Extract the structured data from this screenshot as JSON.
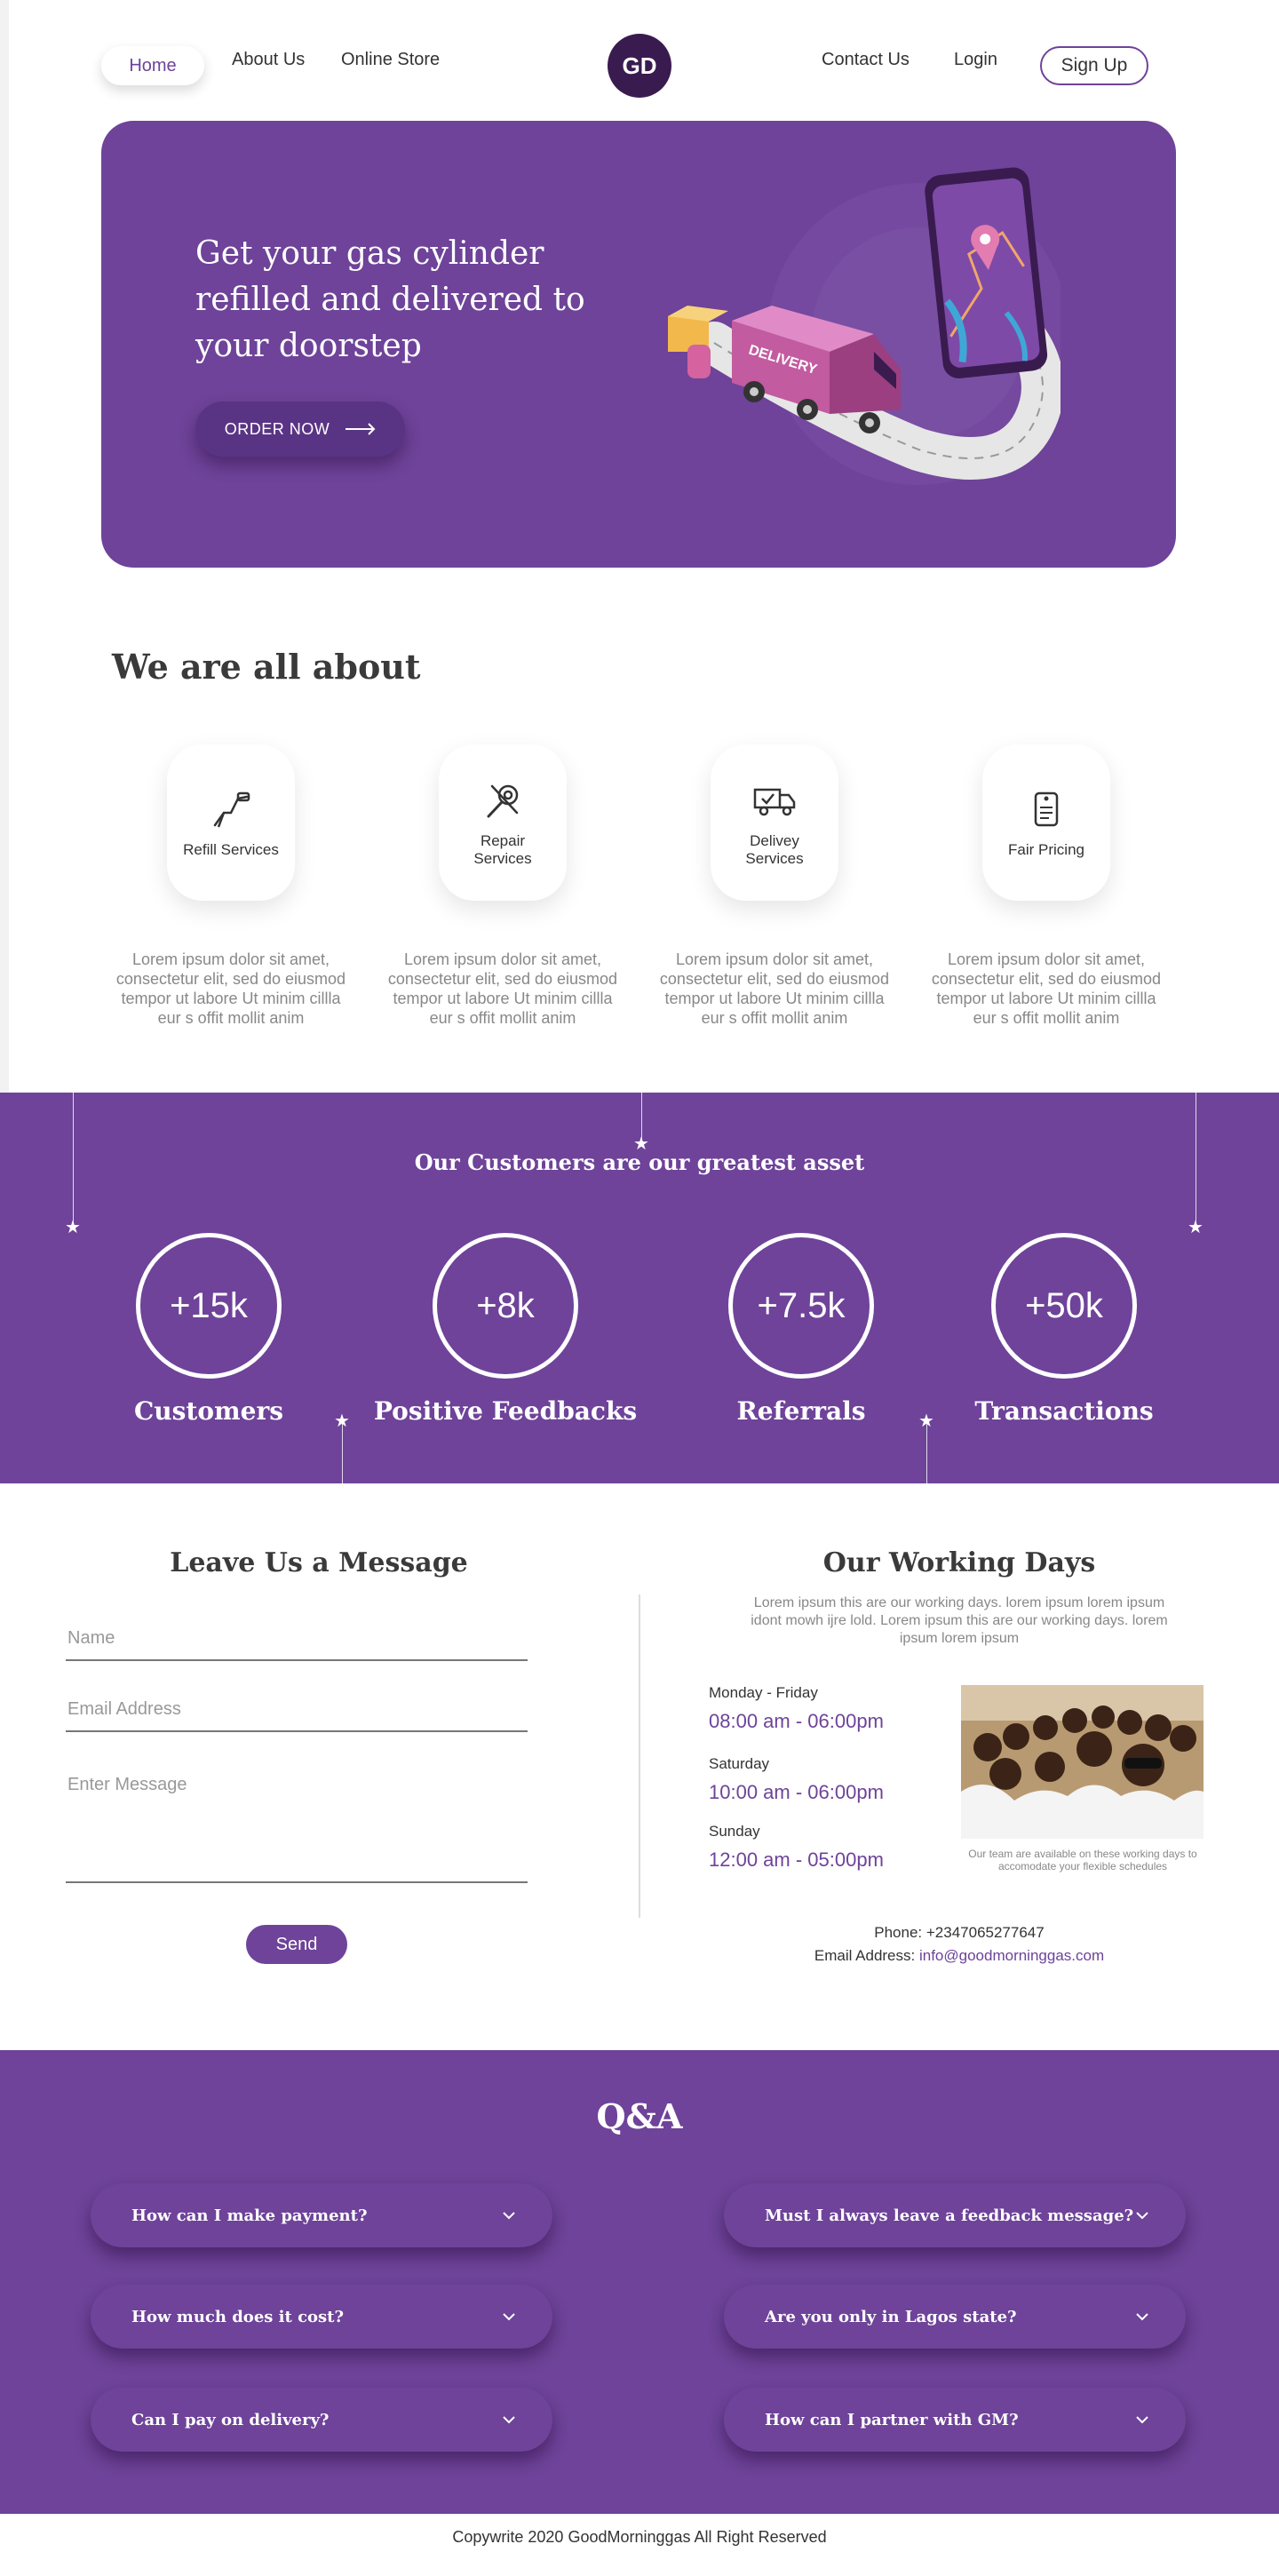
{
  "nav": {
    "home": "Home",
    "about": "About Us",
    "store": "Online Store",
    "logo": "GD",
    "contact": "Contact Us",
    "login": "Login",
    "signup": "Sign Up"
  },
  "hero": {
    "title": "Get your gas cylinder refilled and delivered to your doorstep",
    "cta": "ORDER NOW",
    "van_label": "DELIVERY"
  },
  "about": {
    "title": "We are all about",
    "services": [
      {
        "label": "Refill Services",
        "icon": "gas-nozzle-icon",
        "desc": "Lorem ipsum dolor sit amet, consectetur elit, sed do eiusmod tempor ut labore Ut minim  cillla eur s offit mollit anim"
      },
      {
        "label": "Repair Services",
        "icon": "tools-icon",
        "desc": "Lorem ipsum dolor sit amet, consectetur elit, sed do eiusmod tempor ut labore Ut minim  cillla eur s offit mollit anim"
      },
      {
        "label": "Delivey Services",
        "icon": "delivery-truck-icon",
        "desc": "Lorem ipsum dolor sit amet, consectetur elit, sed do eiusmod tempor ut labore Ut minim  cillla eur s offit mollit anim"
      },
      {
        "label": "Fair Pricing",
        "icon": "price-tag-icon",
        "desc": "Lorem ipsum dolor sit amet, consectetur elit, sed do eiusmod tempor ut labore Ut minim  cillla eur s offit mollit anim"
      }
    ]
  },
  "stats": {
    "title": "Our Customers are our greatest asset",
    "items": [
      {
        "value": "+15k",
        "label": "Customers"
      },
      {
        "value": "+8k",
        "label": "Positive Feedbacks"
      },
      {
        "value": "+7.5k",
        "label": "Referrals"
      },
      {
        "value": "+50k",
        "label": "Transactions"
      }
    ]
  },
  "message": {
    "title": "Leave Us a Message",
    "name_placeholder": "Name",
    "email_placeholder": "Email Address",
    "message_placeholder": "Enter Message",
    "send": "Send"
  },
  "working": {
    "title": "Our Working Days",
    "desc": "Lorem ipsum this are our working days. lorem ipsum lorem ipsum idont mowh ijre lold. Lorem ipsum this are our working days. lorem ipsum lorem ipsum",
    "days": [
      {
        "day": "Monday - Friday",
        "time": "08:00 am - 06:00pm"
      },
      {
        "day": "Saturday",
        "time": "10:00 am - 06:00pm"
      },
      {
        "day": "Sunday",
        "time": "12:00 am - 05:00pm"
      }
    ],
    "caption": "Our team are available on these working days to accomodate your flexible schedules",
    "phone": "Phone: +2347065277647",
    "email_label": "Email Address: ",
    "email": "info@goodmorninggas.com"
  },
  "qa": {
    "title": "Q&A",
    "questions": [
      "How can I make payment?",
      "Must I always leave a feedback message?",
      "How much does it cost?",
      "Are you only in Lagos  state?",
      "Can I pay on delivery?",
      "How can I partner with GM?"
    ]
  },
  "footer": "Copywrite 2020 GoodMorninggas All Right Reserved",
  "colors": {
    "brand": "#6e4399",
    "logo_bg": "#3a1b4f"
  }
}
